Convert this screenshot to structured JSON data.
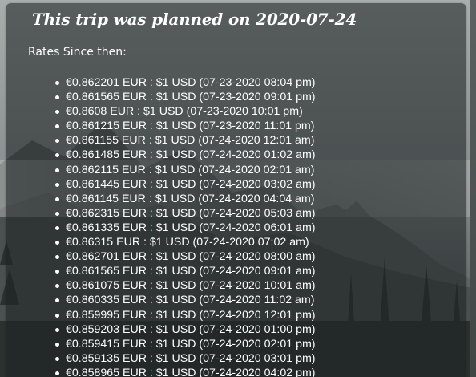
{
  "heading": "This trip was planned on 2020-07-24",
  "subheading": "Rates Since then:",
  "rates": [
    "€0.862201 EUR : $1 USD (07-23-2020 08:04 pm)",
    "€0.861565 EUR : $1 USD (07-23-2020 09:01 pm)",
    "€0.8608 EUR : $1 USD (07-23-2020 10:01 pm)",
    "€0.861215 EUR : $1 USD (07-23-2020 11:01 pm)",
    "€0.861155 EUR : $1 USD (07-24-2020 12:01 am)",
    "€0.861485 EUR : $1 USD (07-24-2020 01:02 am)",
    "€0.862115 EUR : $1 USD (07-24-2020 02:01 am)",
    "€0.861445 EUR : $1 USD (07-24-2020 03:02 am)",
    "€0.861145 EUR : $1 USD (07-24-2020 04:04 am)",
    "€0.862315 EUR : $1 USD (07-24-2020 05:03 am)",
    "€0.861335 EUR : $1 USD (07-24-2020 06:01 am)",
    "€0.86315 EUR : $1 USD (07-24-2020 07:02 am)",
    "€0.862701 EUR : $1 USD (07-24-2020 08:00 am)",
    "€0.861565 EUR : $1 USD (07-24-2020 09:01 am)",
    "€0.861075 EUR : $1 USD (07-24-2020 10:01 am)",
    "€0.860335 EUR : $1 USD (07-24-2020 11:02 am)",
    "€0.859995 EUR : $1 USD (07-24-2020 12:01 pm)",
    "€0.859203 EUR : $1 USD (07-24-2020 01:00 pm)",
    "€0.859415 EUR : $1 USD (07-24-2020 02:01 pm)",
    "€0.859135 EUR : $1 USD (07-24-2020 03:01 pm)",
    "€0.858965 EUR : $1 USD (07-24-2020 04:02 pm)"
  ],
  "colors": {
    "text": "#ffffff",
    "panel": "#1e2224",
    "sky": "#a7adab",
    "forest": "#2b312f"
  },
  "background_image": "foggy-mountain-forest"
}
